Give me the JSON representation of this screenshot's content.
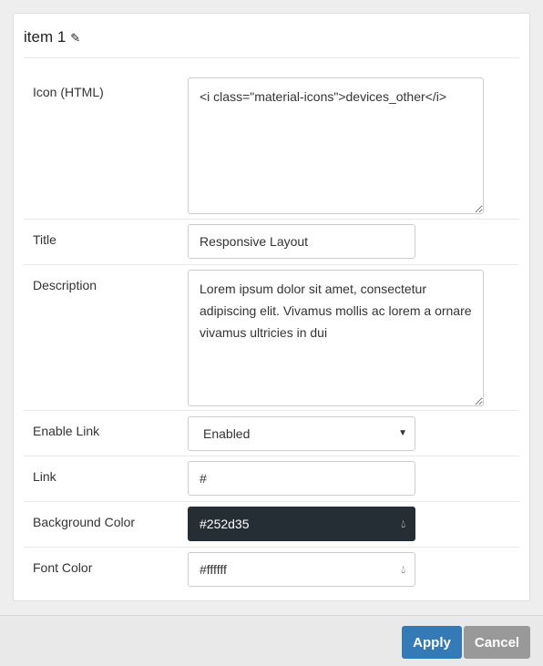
{
  "header": {
    "title": "item 1",
    "edit_icon": "pencil-icon"
  },
  "fields": {
    "icon": {
      "label": "Icon (HTML)",
      "value": "<i class=\"material-icons\">devices_other</i>"
    },
    "title": {
      "label": "Title",
      "value": "Responsive Layout"
    },
    "description": {
      "label": "Description",
      "value": "Lorem ipsum dolor sit amet, consectetur adipiscing elit. Vivamus mollis ac lorem a ornare vivamus ultricies in dui"
    },
    "enable_link": {
      "label": "Enable Link",
      "value": "Enabled"
    },
    "link": {
      "label": "Link",
      "value": "#"
    },
    "background_color": {
      "label": "Background Color",
      "value": "#252d35"
    },
    "font_color": {
      "label": "Font Color",
      "value": "#ffffff"
    }
  },
  "footer": {
    "apply": "Apply",
    "cancel": "Cancel"
  },
  "colors": {
    "apply": "#337ab7",
    "cancel": "#999999"
  }
}
